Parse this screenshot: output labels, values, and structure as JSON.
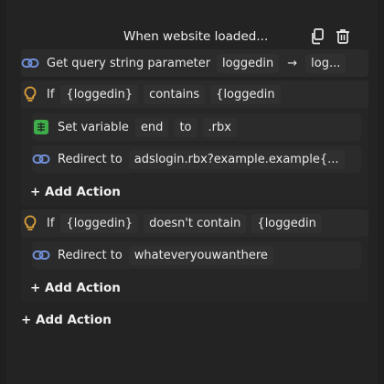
{
  "header": {
    "title": "When website loaded...",
    "copy_icon": "copy-icon",
    "delete_icon": "trash-icon"
  },
  "actions": {
    "get_query": {
      "label": "Get query string parameter",
      "param": "loggedin",
      "arrow": "→",
      "target": "log..."
    },
    "if1": {
      "keyword": "If",
      "left": "{loggedin}",
      "op": "contains",
      "right": "{loggedin"
    },
    "set_var": {
      "label": "Set variable",
      "name": "end",
      "to": "to",
      "value": ".rbx"
    },
    "redirect1": {
      "label": "Redirect to",
      "url": "adslogin.rbx?example.example{..."
    },
    "add_action_1": "+ Add Action",
    "if2": {
      "keyword": "If",
      "left": "{loggedin}",
      "op": "doesn't contain",
      "right": "{loggedin"
    },
    "redirect2": {
      "label": "Redirect to",
      "url": "whateveryouwanthere"
    },
    "add_action_2": "+ Add Action",
    "add_action_root": "+ Add Action"
  },
  "colors": {
    "link_icon": "#6f8fd8",
    "bulb_icon": "#e0a33a",
    "var_icon": "#3fae4a"
  }
}
